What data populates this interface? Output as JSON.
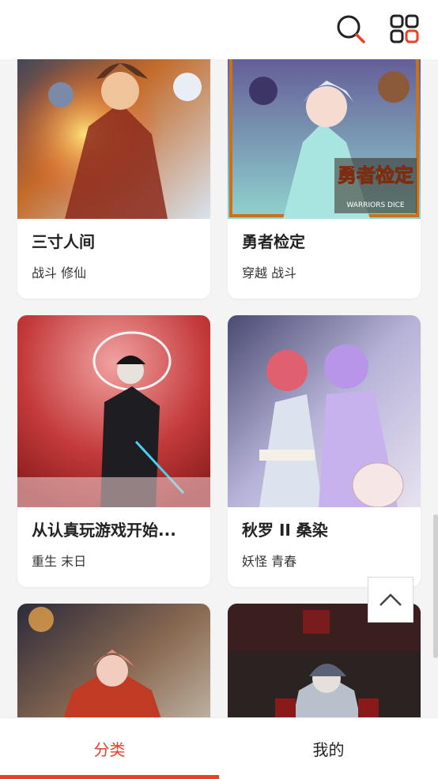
{
  "header": {
    "search_icon": "search-icon",
    "grid_icon": "grid-menu-icon"
  },
  "comics": [
    {
      "title": "三寸人间",
      "tags": "战斗 修仙"
    },
    {
      "title": "勇者检定",
      "tags": "穿越 战斗",
      "cover_text": "勇者检定",
      "cover_subtext": "WARRIORS DICE"
    },
    {
      "title": "从认真玩游戏开始...",
      "tags": "重生 末日"
    },
    {
      "title": "秋罗 II 桑染",
      "tags": "妖怪 青春"
    },
    {
      "title": "",
      "tags": ""
    },
    {
      "title": "",
      "tags": ""
    }
  ],
  "tabs": [
    {
      "label": "分类",
      "active": true
    },
    {
      "label": "我的",
      "active": false
    }
  ],
  "colors": {
    "accent": "#e8402a",
    "background": "#f4f4f4"
  }
}
